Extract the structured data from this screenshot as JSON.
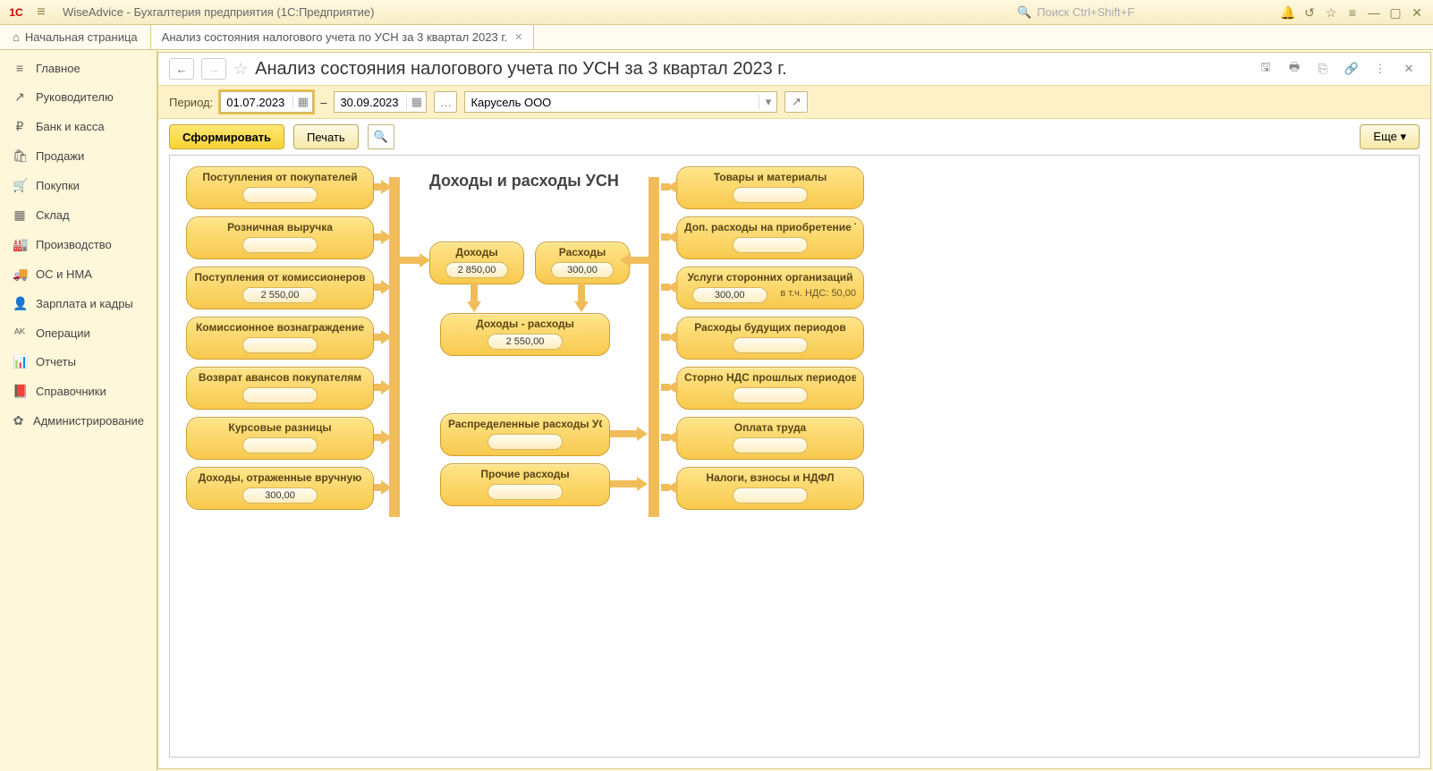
{
  "app": {
    "title": "WiseAdvice - Бухгалтерия предприятия  (1С:Предприятие)",
    "search_placeholder": "Поиск Ctrl+Shift+F"
  },
  "tabs": {
    "home": "Начальная страница",
    "current": "Анализ состояния налогового учета по УСН за 3 квартал 2023 г."
  },
  "sidebar": {
    "items": [
      {
        "icon": "≡",
        "label": "Главное"
      },
      {
        "icon": "↗",
        "label": "Руководителю"
      },
      {
        "icon": "₽",
        "label": "Банк и касса"
      },
      {
        "icon": "🛍",
        "label": "Продажи"
      },
      {
        "icon": "🛒",
        "label": "Покупки"
      },
      {
        "icon": "▦",
        "label": "Склад"
      },
      {
        "icon": "🏭",
        "label": "Производство"
      },
      {
        "icon": "🚚",
        "label": "ОС и НМА"
      },
      {
        "icon": "👤",
        "label": "Зарплата и кадры"
      },
      {
        "icon": "ᴬᴷ",
        "label": "Операции"
      },
      {
        "icon": "📊",
        "label": "Отчеты"
      },
      {
        "icon": "📕",
        "label": "Справочники"
      },
      {
        "icon": "✿",
        "label": "Администрирование"
      }
    ]
  },
  "page": {
    "title": "Анализ состояния налогового учета по УСН за 3 квартал 2023 г.",
    "period_label": "Период:",
    "date_from": "01.07.2023",
    "date_to": "30.09.2023",
    "dash": "–",
    "org": "Карусель ООО",
    "btn_form": "Сформировать",
    "btn_print": "Печать",
    "btn_more": "Еще"
  },
  "diagram": {
    "title": "Доходы и расходы УСН",
    "left": [
      {
        "label": "Поступления от покупателей",
        "value": ""
      },
      {
        "label": "Розничная выручка",
        "value": ""
      },
      {
        "label": "Поступления от комиссионеров",
        "value": "2 550,00"
      },
      {
        "label": "Комиссионное вознаграждение",
        "value": ""
      },
      {
        "label": "Возврат авансов покупателям",
        "value": ""
      },
      {
        "label": "Курсовые разницы",
        "value": ""
      },
      {
        "label": "Доходы, отраженные вручную",
        "value": "300,00"
      }
    ],
    "right": [
      {
        "label": "Товары и материалы",
        "value": ""
      },
      {
        "label": "Доп. расходы на приобретение ТМЦ",
        "value": ""
      },
      {
        "label": "Услуги сторонних организаций",
        "value": "300,00",
        "extra": "в т.ч. НДС: 50,00"
      },
      {
        "label": "Расходы будущих периодов",
        "value": ""
      },
      {
        "label": "Сторно НДС прошлых периодов",
        "value": ""
      },
      {
        "label": "Оплата труда",
        "value": ""
      },
      {
        "label": "Налоги, взносы и НДФЛ",
        "value": ""
      }
    ],
    "center": {
      "income": {
        "label": "Доходы",
        "value": "2 850,00"
      },
      "expense": {
        "label": "Расходы",
        "value": "300,00"
      },
      "net": {
        "label": "Доходы - расходы",
        "value": "2 550,00"
      },
      "dist": {
        "label": "Распределенные расходы УСН",
        "value": ""
      },
      "other": {
        "label": "Прочие расходы",
        "value": ""
      }
    }
  }
}
